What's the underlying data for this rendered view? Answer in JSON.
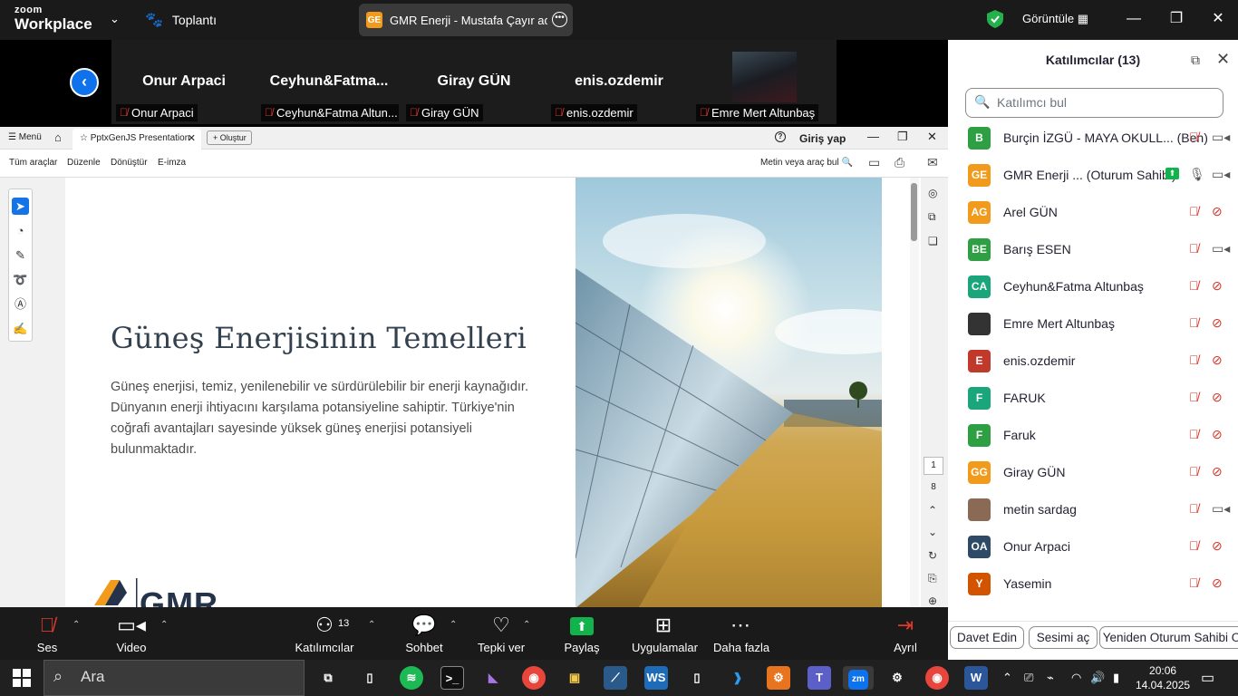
{
  "zoom_top": {
    "logo_line1": "zoom",
    "logo_line2": "Workplace",
    "meeting_label": "Toplantı",
    "share_badge": "GE",
    "share_title": "GMR Enerji - Mustafa Çayır adlı k",
    "view_label": "Görüntüle"
  },
  "gallery": {
    "tiles": [
      {
        "big": "Onur Arpaci",
        "label": "Onur Arpaci"
      },
      {
        "big": "Ceyhun&Fatma...",
        "label": "Ceyhun&Fatma Altun..."
      },
      {
        "big": "Giray GÜN",
        "label": "Giray GÜN"
      },
      {
        "big": "enis.ozdemir",
        "label": "enis.ozdemir"
      },
      {
        "big": "",
        "label": "Emre Mert Altunbaş"
      }
    ]
  },
  "pdf": {
    "menu_label": "Menü",
    "tab_title": "PptxGenJS Presentation",
    "new_tab_label": "Oluştur",
    "login_label": "Giriş yap",
    "menus": [
      "Tüm araçlar",
      "Düzenle",
      "Dönüştür",
      "E-imza"
    ],
    "search_tools": "Metin veya araç bul",
    "page_current": "1",
    "page_total": "8",
    "slide": {
      "title": "Güneş Enerjisinin Temelleri",
      "body": "Güneş enerjisi, temiz, yenilenebilir ve sürdürülebilir bir enerji kaynağıdır. Dünyanın enerji ihtiyacını karşılama potansiyeline sahiptir. Türkiye'nin coğrafi avantajları sayesinde yüksek güneş enerjisi potansiyeli bulunmaktadır.",
      "logo_text": "GMR"
    }
  },
  "toolbar": {
    "audio": "Ses",
    "video": "Video",
    "participants": "Katılımcılar",
    "participants_count": "13",
    "chat": "Sohbet",
    "react": "Tepki ver",
    "share": "Paylaş",
    "apps": "Uygulamalar",
    "more": "Daha fazla",
    "leave": "Ayrıl"
  },
  "panel": {
    "title": "Katılımcılar (13)",
    "search_placeholder": "Katılımcı bul",
    "participants": [
      {
        "initials": "B",
        "name": "Burçin İZGÜ - MAYA OKULL... (Ben)",
        "color": "#2ea043",
        "mic": "off",
        "cam": "on"
      },
      {
        "initials": "GE",
        "name": "GMR Enerji ... (Oturum Sahibi)",
        "color": "#f29a1b",
        "mic": "on",
        "cam": "on",
        "sharing": true
      },
      {
        "initials": "AG",
        "name": "Arel GÜN",
        "color": "#f29a1b",
        "mic": "off",
        "cam": "off"
      },
      {
        "initials": "BE",
        "name": "Barış ESEN",
        "color": "#2ea043",
        "mic": "off",
        "cam": "on"
      },
      {
        "initials": "CA",
        "name": "Ceyhun&Fatma Altunbaş",
        "color": "#1aa67a",
        "mic": "off",
        "cam": "off"
      },
      {
        "initials": "",
        "name": "Emre Mert Altunbaş",
        "color": "#333333",
        "mic": "off",
        "cam": "off"
      },
      {
        "initials": "E",
        "name": "enis.ozdemir",
        "color": "#c0392b",
        "mic": "off",
        "cam": "off"
      },
      {
        "initials": "F",
        "name": "FARUK",
        "color": "#1aa67a",
        "mic": "off",
        "cam": "off"
      },
      {
        "initials": "F",
        "name": "Faruk",
        "color": "#2ea043",
        "mic": "off",
        "cam": "off"
      },
      {
        "initials": "GG",
        "name": "Giray GÜN",
        "color": "#f29a1b",
        "mic": "off",
        "cam": "off"
      },
      {
        "initials": "",
        "name": "metin sardag",
        "color": "#8a6a55",
        "mic": "off",
        "cam": "on"
      },
      {
        "initials": "OA",
        "name": "Onur Arpaci",
        "color": "#2e4a66",
        "mic": "off",
        "cam": "off"
      },
      {
        "initials": "Y",
        "name": "Yasemin",
        "color": "#d35400",
        "mic": "off",
        "cam": "off"
      }
    ],
    "buttons": [
      "Davet Edin",
      "Sesimi aç",
      "Yeniden Oturum Sahibi O"
    ]
  },
  "taskbar": {
    "search_placeholder": "Ara",
    "time": "20:06",
    "date": "14.04.2025"
  },
  "colors": {
    "zoom_blue": "#0e72ed",
    "share_green": "#12b24c",
    "muted_red": "#d93025",
    "acrobat_blue": "#1473e6"
  }
}
